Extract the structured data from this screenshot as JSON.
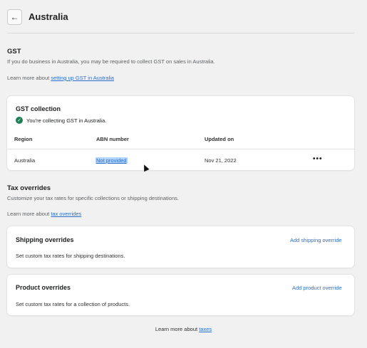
{
  "header": {
    "back_icon": "arrow-left-icon",
    "title": "Australia"
  },
  "gst": {
    "title": "GST",
    "description": "If you do business in Australia, you may be required to collect GST on sales in Australia.",
    "learn_prefix": "Learn more about",
    "learn_link": "setting up GST in Australia"
  },
  "gst_collection": {
    "title": "GST collection",
    "status_icon": "check-circle-icon",
    "status_text": "You're collecting GST in Australia.",
    "columns": {
      "region": "Region",
      "abn": "ABN number",
      "updated": "Updated on"
    },
    "row": {
      "region": "Australia",
      "abn": "Not provided",
      "updated": "Nov 21, 2022",
      "more": "•••"
    }
  },
  "tax_overrides": {
    "title": "Tax overrides",
    "description": "Customize your tax rates for specific collections or shipping destinations.",
    "learn_prefix": "Learn more about",
    "learn_link": "tax overrides"
  },
  "shipping_overrides": {
    "title": "Shipping overrides",
    "action": "Add shipping override",
    "description": "Set custom tax rates for shipping destinations."
  },
  "product_overrides": {
    "title": "Product overrides",
    "action": "Add product override",
    "description": "Set custom tax rates for a collection of products."
  },
  "footer": {
    "prefix": "Learn more about",
    "link": "taxes"
  },
  "colors": {
    "link": "#2c6ecb",
    "success": "#1f7f56",
    "selection": "#b3d4fc"
  }
}
